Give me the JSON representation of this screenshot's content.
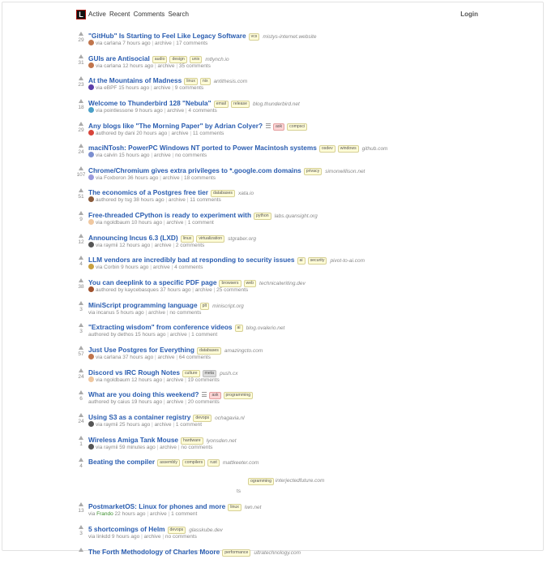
{
  "header": {
    "logo_letter": "L",
    "nav": [
      "Active",
      "Recent",
      "Comments",
      "Search"
    ],
    "login": "Login"
  },
  "stories": [
    {
      "score": "29",
      "title": "\"GitHub\" Is Starting to Feel Like Legacy Software",
      "tags": [
        {
          "label": "vcs",
          "kind": "normal"
        }
      ],
      "domain": "mistys-internet.website",
      "prefix": "via",
      "user": "carlana",
      "user_class": "",
      "avatar": "#c0754c",
      "time": "7 hours ago",
      "archive": "archive",
      "comments": "17 comments"
    },
    {
      "score": "31",
      "title": "GUIs are Antisocial",
      "tags": [
        {
          "label": "audio",
          "kind": "normal"
        },
        {
          "label": "design",
          "kind": "normal"
        },
        {
          "label": "unix",
          "kind": "normal"
        }
      ],
      "domain": "mtlynch.io",
      "prefix": "via",
      "user": "carlana",
      "user_class": "",
      "avatar": "#c0754c",
      "time": "12 hours ago",
      "archive": "archive",
      "comments": "35 comments"
    },
    {
      "score": "23",
      "title": "At the Mountains of Madness",
      "tags": [
        {
          "label": "linux",
          "kind": "normal"
        },
        {
          "label": "nix",
          "kind": "normal"
        }
      ],
      "domain": "antithesis.com",
      "prefix": "via",
      "user": "eBPF",
      "user_class": "",
      "avatar": "#5b3fa8",
      "time": "15 hours ago",
      "archive": "archive",
      "comments": "9 comments"
    },
    {
      "score": "18",
      "title": "Welcome to Thunderbird 128 \"Nebula\"",
      "tags": [
        {
          "label": "email",
          "kind": "normal"
        },
        {
          "label": "release",
          "kind": "normal"
        }
      ],
      "domain": "blog.thunderbird.net",
      "prefix": "via",
      "user": "pointlessone",
      "user_class": "",
      "avatar": "#4aa0c8",
      "time": "9 hours ago",
      "archive": "archive",
      "comments": "4 comments"
    },
    {
      "score": "29",
      "title": "Any blogs like \"The Morning Paper\" by Adrian Colyer?",
      "ask": true,
      "tags": [
        {
          "label": "ask",
          "kind": "ask"
        },
        {
          "label": "compsci",
          "kind": "normal"
        }
      ],
      "domain": "",
      "prefix": "authored by",
      "user": "dani",
      "user_class": "",
      "avatar": "#d8443a",
      "time": "20 hours ago",
      "archive": "archive",
      "comments": "11 comments"
    },
    {
      "score": "24",
      "title": "maciNTosh: PowerPC Windows NT ported to Power Macintosh systems",
      "tags": [
        {
          "label": "osdev",
          "kind": "normal"
        },
        {
          "label": "windows",
          "kind": "normal"
        }
      ],
      "domain": "github.com",
      "prefix": "via",
      "user": "calvin",
      "user_class": "",
      "avatar": "#7b8fd0",
      "time": "15 hours ago",
      "archive": "archive",
      "comments": "no comments"
    },
    {
      "score": "107",
      "title": "Chrome/Chromium gives extra privileges to *.google.com domains",
      "tags": [
        {
          "label": "privacy",
          "kind": "normal"
        }
      ],
      "domain": "simonwillison.net",
      "prefix": "via",
      "user": "Foxboron",
      "user_class": "",
      "avatar": "#9a9adc",
      "time": "36 hours ago",
      "archive": "archive",
      "comments": "18 comments"
    },
    {
      "score": "51",
      "title": "The economics of a Postgres free tier",
      "tags": [
        {
          "label": "databases",
          "kind": "normal"
        }
      ],
      "domain": "xata.io",
      "prefix": "authored by",
      "user": "tsg",
      "user_class": "",
      "avatar": "#8a5a3a",
      "time": "38 hours ago",
      "archive": "archive",
      "comments": "11 comments"
    },
    {
      "score": "9",
      "title": "Free-threaded CPython is ready to experiment with",
      "tags": [
        {
          "label": "python",
          "kind": "normal"
        }
      ],
      "domain": "labs.quansight.org",
      "prefix": "via",
      "user": "ngoldbaum",
      "user_class": "",
      "avatar": "#f0c8a0",
      "time": "10 hours ago",
      "archive": "archive",
      "comments": "1 comment"
    },
    {
      "score": "12",
      "title": "Announcing Incus 6.3 (LXD)",
      "tags": [
        {
          "label": "linux",
          "kind": "normal"
        },
        {
          "label": "virtualization",
          "kind": "normal"
        }
      ],
      "domain": "stgraber.org",
      "prefix": "via",
      "user": "raymii",
      "user_class": "",
      "avatar": "#555555",
      "time": "12 hours ago",
      "archive": "archive",
      "comments": "2 comments"
    },
    {
      "score": "4",
      "title": "LLM vendors are incredibly bad at responding to security issues",
      "tags": [
        {
          "label": "ai",
          "kind": "normal"
        },
        {
          "label": "security",
          "kind": "normal"
        }
      ],
      "domain": "pivot-to-ai.com",
      "prefix": "via",
      "user": "Corbin",
      "user_class": "",
      "avatar": "#c8a040",
      "time": "9 hours ago",
      "archive": "archive",
      "comments": "4 comments"
    },
    {
      "score": "38",
      "title": "You can deeplink to a specific PDF page",
      "tags": [
        {
          "label": "browsers",
          "kind": "normal"
        },
        {
          "label": "web",
          "kind": "normal"
        }
      ],
      "domain": "technicalwriting.dev",
      "prefix": "authored by",
      "user": "kaycebasques",
      "user_class": "",
      "avatar": "#a0522d",
      "time": "37 hours ago",
      "archive": "archive",
      "comments": "25 comments"
    },
    {
      "score": "3",
      "title": "MiniScript programming language",
      "tags": [
        {
          "label": "plt",
          "kind": "normal"
        }
      ],
      "domain": "miniscript.org",
      "prefix": "via",
      "user": "incanus",
      "user_class": "",
      "avatar": "",
      "time": "5 hours ago",
      "archive": "archive",
      "comments": "no comments"
    },
    {
      "score": "3",
      "title": "\"Extracting wisdom\" from conference videos",
      "tags": [
        {
          "label": "ai",
          "kind": "normal"
        }
      ],
      "domain": "blog.ovalerio.net",
      "prefix": "authored by",
      "user": "dethos",
      "user_class": "",
      "avatar": "",
      "time": "15 hours ago",
      "archive": "archive",
      "comments": "1 comment"
    },
    {
      "score": "57",
      "title": "Just Use Postgres for Everything",
      "tags": [
        {
          "label": "databases",
          "kind": "normal"
        }
      ],
      "domain": "amazingcto.com",
      "prefix": "via",
      "user": "carlana",
      "user_class": "",
      "avatar": "#c0754c",
      "time": "37 hours ago",
      "archive": "archive",
      "comments": "64 comments"
    },
    {
      "score": "24",
      "title": "Discord vs IRC Rough Notes",
      "tags": [
        {
          "label": "culture",
          "kind": "normal"
        },
        {
          "label": "meta",
          "kind": "meta"
        }
      ],
      "domain": "push.cx",
      "prefix": "via",
      "user": "ngoldbaum",
      "user_class": "",
      "avatar": "#f0c8a0",
      "time": "12 hours ago",
      "archive": "archive",
      "comments": "19 comments"
    },
    {
      "score": "6",
      "title": "What are you doing this weekend?",
      "ask": true,
      "tags": [
        {
          "label": "ask",
          "kind": "ask"
        },
        {
          "label": "programming",
          "kind": "normal"
        }
      ],
      "domain": "",
      "prefix": "authored by",
      "user": "caius",
      "user_class": "",
      "avatar": "",
      "time": "19 hours ago",
      "archive": "archive",
      "comments": "20 comments"
    },
    {
      "score": "24",
      "title": "Using S3 as a container registry",
      "tags": [
        {
          "label": "devops",
          "kind": "normal"
        }
      ],
      "domain": "ochagavia.nl",
      "prefix": "via",
      "user": "raymii",
      "user_class": "",
      "avatar": "#555555",
      "time": "25 hours ago",
      "archive": "archive",
      "comments": "1 comment"
    },
    {
      "score": "1",
      "title": "Wireless Amiga Tank Mouse",
      "tags": [
        {
          "label": "hardware",
          "kind": "normal"
        }
      ],
      "domain": "lyonsden.net",
      "prefix": "via",
      "user": "raymii",
      "user_class": "",
      "avatar": "#555555",
      "time": "59 minutes ago",
      "archive": "archive",
      "comments": "no comments"
    },
    {
      "score": "4",
      "title": "Beating the compiler",
      "tags": [
        {
          "label": "assembly",
          "kind": "normal"
        },
        {
          "label": "compilers",
          "kind": "normal"
        },
        {
          "label": "rust",
          "kind": "normal"
        }
      ],
      "domain": "mattkeeter.com",
      "prefix": "",
      "user": "",
      "user_class": "",
      "avatar": "",
      "time": "",
      "archive": "",
      "comments": ""
    },
    {
      "score": "",
      "title": "",
      "tags": [],
      "domain": "",
      "prefix": "",
      "user": "",
      "user_class": "",
      "avatar": "",
      "time": "",
      "archive": "",
      "comments": ""
    },
    {
      "score": "13",
      "title": "PostmarketOS: Linux for phones and more",
      "tags": [
        {
          "label": "linux",
          "kind": "normal"
        }
      ],
      "domain": "lwn.net",
      "prefix": "via",
      "user": "Frando",
      "user_class": "new",
      "avatar": "",
      "time": "22 hours ago",
      "archive": "archive",
      "comments": "1 comment"
    },
    {
      "score": "3",
      "title": "5 shortcomings of Helm",
      "tags": [
        {
          "label": "devops",
          "kind": "normal"
        }
      ],
      "domain": "glasskube.dev",
      "prefix": "via",
      "user": "linkdd",
      "user_class": "",
      "avatar": "",
      "time": "9 hours ago",
      "archive": "archive",
      "comments": "no comments"
    },
    {
      "score": "",
      "title": "The Forth Methodology of Charles Moore",
      "tags": [
        {
          "label": "performance",
          "kind": "normal"
        }
      ],
      "domain": "ultratechnology.com",
      "prefix": "",
      "user": "",
      "user_class": "",
      "avatar": "",
      "time": "",
      "archive": "",
      "comments": ""
    }
  ],
  "stray": {
    "tag": "ogramming",
    "domain": "interjectedfuture.com",
    "fragment": "ts"
  }
}
